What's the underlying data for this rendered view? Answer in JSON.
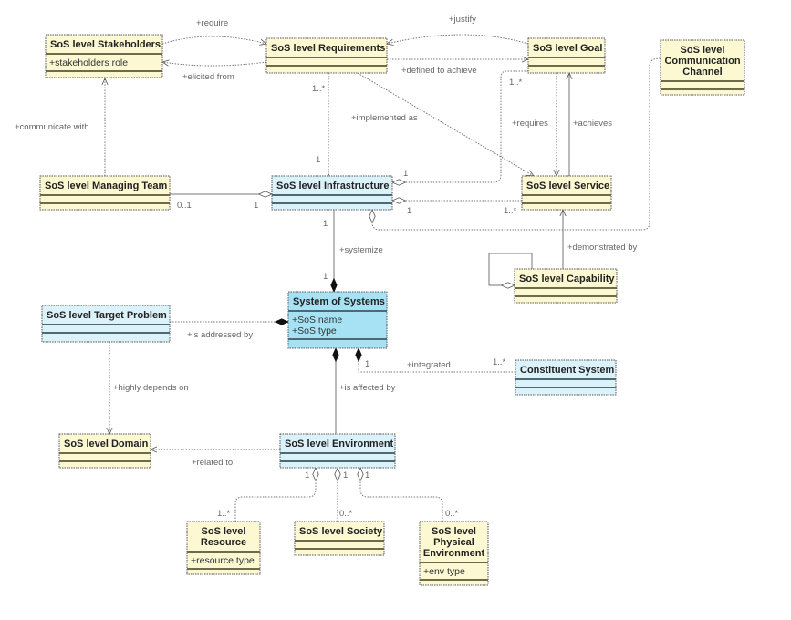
{
  "colors": {
    "class_yellow": "#fbf8d2",
    "class_blue_light": "#dcf2fb",
    "class_blue": "#a6e2f4"
  },
  "classes": [
    {
      "id": "stakeholders",
      "name": [
        "SoS level Stakeholders"
      ],
      "attrs": [
        "+stakeholders role"
      ],
      "color": "yellow"
    },
    {
      "id": "requirements",
      "name": [
        "SoS level Requirements"
      ],
      "attrs": [],
      "color": "yellow"
    },
    {
      "id": "goal",
      "name": [
        "SoS level Goal"
      ],
      "attrs": [],
      "color": "yellow"
    },
    {
      "id": "comm",
      "name": [
        "SoS level",
        "Communication",
        "Channel"
      ],
      "attrs": [],
      "color": "yellow"
    },
    {
      "id": "team",
      "name": [
        "SoS level Managing Team"
      ],
      "attrs": [],
      "color": "yellow"
    },
    {
      "id": "infra",
      "name": [
        "SoS level Infrastructure"
      ],
      "attrs": [],
      "color": "blue_light"
    },
    {
      "id": "service",
      "name": [
        "SoS level Service"
      ],
      "attrs": [],
      "color": "yellow"
    },
    {
      "id": "capability",
      "name": [
        "SoS level Capability"
      ],
      "attrs": [],
      "color": "yellow"
    },
    {
      "id": "sos",
      "name": [
        "System of Systems"
      ],
      "attrs": [
        "+SoS name",
        "+SoS type"
      ],
      "color": "blue"
    },
    {
      "id": "target",
      "name": [
        "SoS level Target Problem"
      ],
      "attrs": [],
      "color": "blue_light"
    },
    {
      "id": "constituent",
      "name": [
        "Constituent System"
      ],
      "attrs": [],
      "color": "blue_light"
    },
    {
      "id": "domain",
      "name": [
        "SoS level Domain"
      ],
      "attrs": [],
      "color": "yellow"
    },
    {
      "id": "environment",
      "name": [
        "SoS level Environment"
      ],
      "attrs": [],
      "color": "blue_light"
    },
    {
      "id": "resource",
      "name": [
        "SoS level",
        "Resource"
      ],
      "attrs": [
        "+resource type"
      ],
      "color": "yellow"
    },
    {
      "id": "society",
      "name": [
        "SoS level Society"
      ],
      "attrs": [],
      "color": "yellow"
    },
    {
      "id": "physical",
      "name": [
        "SoS level",
        "Physical",
        "Environment"
      ],
      "attrs": [
        "+env type"
      ],
      "color": "yellow"
    }
  ],
  "edges": {
    "require": "+require",
    "elicited_from": "+elicited from",
    "justify": "+justify",
    "defined_to_achieve": "+defined to achieve",
    "communicate_with": "+communicate with",
    "implemented_as": "+implemented as",
    "requires": "+requires",
    "achieves": "+achieves",
    "systemize": "+systemize",
    "demonstrated_by": "+demonstrated by",
    "is_addressed_by": "+is addressed by",
    "integrated": "+integrated",
    "highly_depends_on": "+highly depends on",
    "is_affected_by": "+is affected by",
    "related_to": "+related to"
  },
  "multiplicities": {
    "req_infra_top": "1..*",
    "req_infra_bottom": "1",
    "team": "0..1",
    "team_infra": "1",
    "goal_infra": "1..*",
    "infra_goal": "1",
    "infra_service": "1",
    "service_infra": "1..*",
    "infra_sos_top": "1",
    "infra_sos_bottom": "1",
    "sos_const": "1",
    "const_sos": "1..*",
    "env_res": "1",
    "env_soc": "1",
    "env_phys": "1",
    "res": "1..*",
    "soc": "0..*",
    "phys": "0..*"
  }
}
